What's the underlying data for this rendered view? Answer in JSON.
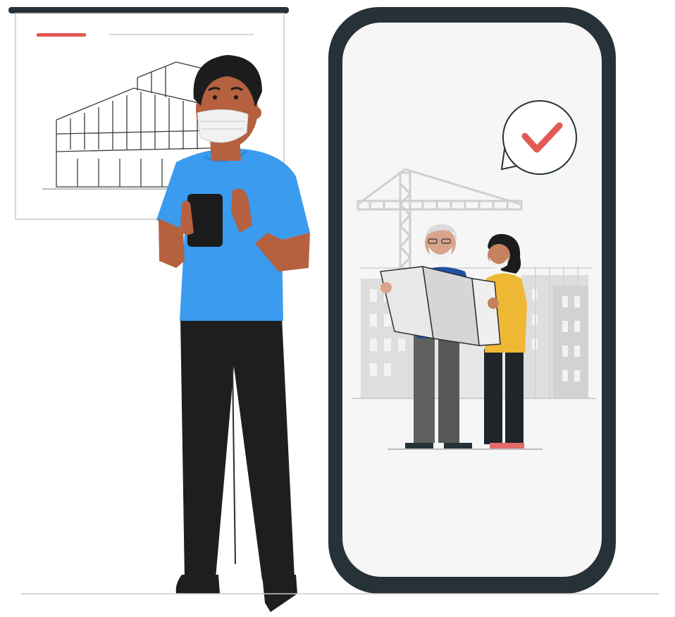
{
  "illustration": {
    "colors": {
      "outline": "#263238",
      "accent_red": "#e25a54",
      "shirt_blue": "#3a9bef",
      "skin": "#b5603e",
      "hair": "#1c1c1c",
      "pants": "#1e1e1e",
      "phone_screen": "#f6f6f6",
      "building_gray": "#dcdcdc",
      "crane_gray": "#cfcfcf",
      "engineer_shirt": "#1f4fa0",
      "engineer_pants": "#606060",
      "woman_top": "#eeb834",
      "woman_pants": "#1f252b",
      "shoe_pink": "#e46a6a",
      "mask": "#f1f1f1",
      "blueprint": "#e8e8e8"
    },
    "icons": [
      "building-sketch-board",
      "smartphone",
      "checkmark-badge",
      "construction-crane"
    ]
  }
}
